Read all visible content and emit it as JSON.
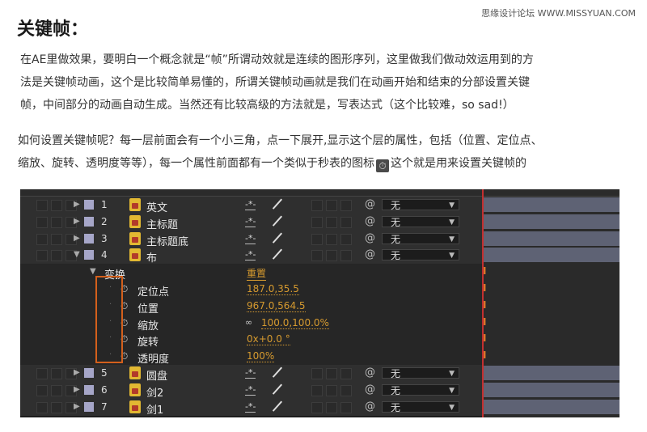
{
  "heading": "关键帧：",
  "watermark": "思缘设计论坛 WWW.MISSYUAN.COM",
  "paragraph1_lines": [
    "在AE里做效果，要明白一个概念就是“帧”所谓动效就是连续的图形序列，这里做我们做动效运用到的方",
    "法是关键帧动画，这个是比较简单易懂的，所谓关键帧动画就是我们在动画开始和结束的分部设置关键",
    "帧，中间部分的动画自动生成。当然还有比较高级的方法就是，写表达式（这个比较难，so sad!）"
  ],
  "paragraph2_line1": "如何设置关键帧呢？每一层前面会有一个小三角，点一下展开,显示这个层的属性，包括（位置、定位点、",
  "paragraph2_line2a": "缩放、旋转、透明度等等），每一个属性前面都有一个类似于秒表的图标",
  "paragraph2_line2b": "这个就是用来设置关键帧的",
  "inline_icon": "stopwatch-icon",
  "panel": {
    "layers_top": [
      {
        "num": "1",
        "name": "英文",
        "mode": "无"
      },
      {
        "num": "2",
        "name": "主标题",
        "mode": "无"
      },
      {
        "num": "3",
        "name": "主标题底",
        "mode": "无"
      },
      {
        "num": "4",
        "name": "布",
        "mode": "无"
      }
    ],
    "transform": {
      "label": "变换",
      "reset": "重置"
    },
    "properties": [
      {
        "name": "定位点",
        "value": "187.0,35.5"
      },
      {
        "name": "位置",
        "value": "967.0,564.5"
      },
      {
        "name": "缩放",
        "value": "100.0,100.0%"
      },
      {
        "name": "旋转",
        "value": "0x+0.0 °"
      },
      {
        "name": "透明度",
        "value": "100%"
      }
    ],
    "layers_bottom": [
      {
        "num": "5",
        "name": "圆盘",
        "mode": "无"
      },
      {
        "num": "6",
        "name": "剑2",
        "mode": "无"
      },
      {
        "num": "7",
        "name": "剑1",
        "mode": "无"
      }
    ],
    "switch_glyph": "-*-",
    "keyframe_glyph": "I",
    "colors": {
      "highlight": "#d4601c",
      "value": "#d69a2f",
      "layer_label": "#a6a6c8",
      "playhead": "#c23030",
      "bar": "#5e6274"
    }
  }
}
